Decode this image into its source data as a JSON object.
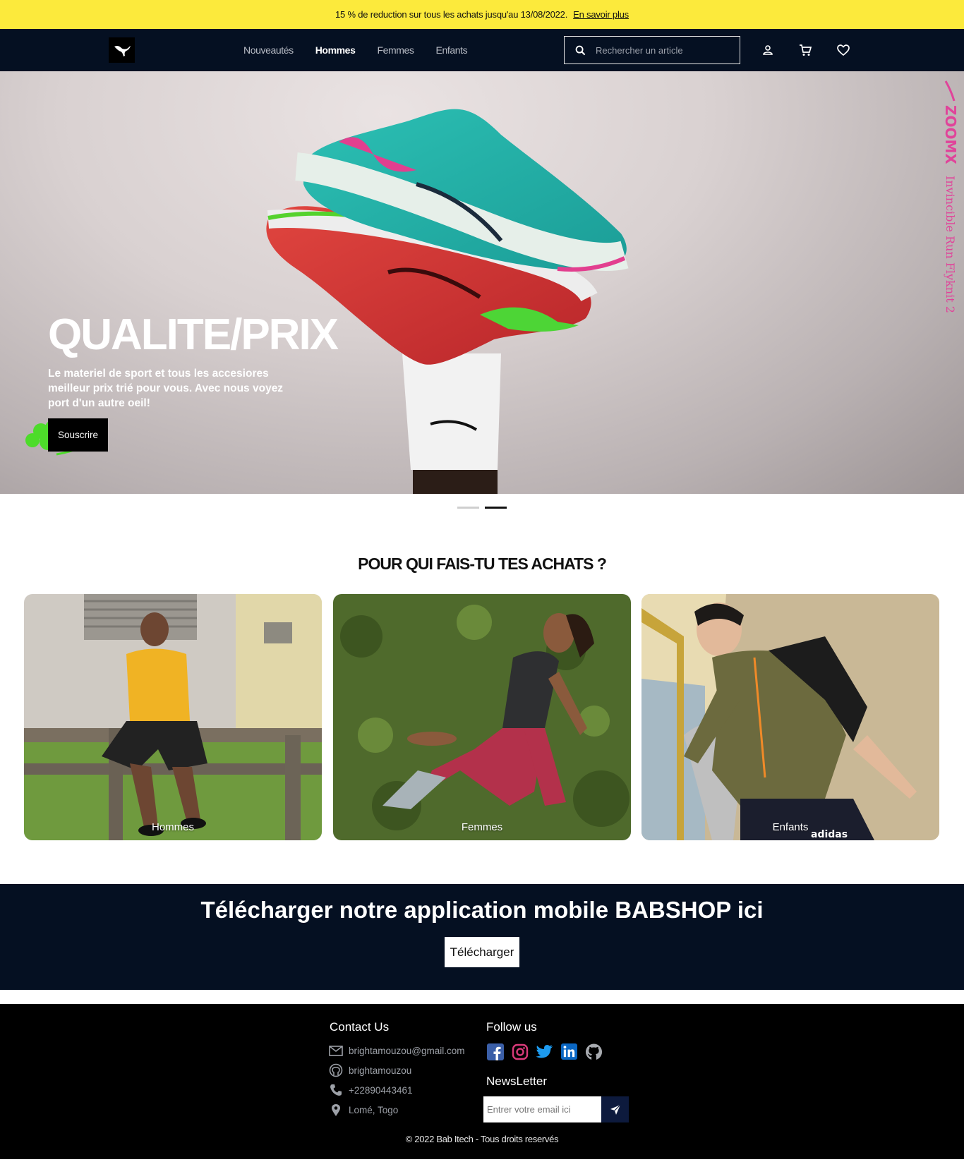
{
  "promo": {
    "text": "15 % de reduction sur tous les achats jusqu'au 13/08/2022.",
    "link": "En savoir plus"
  },
  "nav": {
    "links": [
      "Nouveautés",
      "Hommes",
      "Femmes",
      "Enfants"
    ],
    "active": "Hommes",
    "search_placeholder": "Rechercher un article",
    "icons": [
      "user-icon",
      "cart-icon",
      "heart-icon"
    ]
  },
  "hero": {
    "title": "QUALITE/PRIX",
    "text": "Le materiel de sport et tous les accesiores meilleur prix trié pour vous. Avec nous voyez port d'un autre oeil!",
    "button": "Souscrire",
    "vertical_brand": "ZOOMX",
    "vertical_product": "Invincible Run Flyknit 2",
    "slides": 2,
    "active_slide": 2
  },
  "section": {
    "title": "POUR QUI FAIS-TU TES ACHATS ?"
  },
  "categories": [
    {
      "label": "Hommes"
    },
    {
      "label": "Femmes"
    },
    {
      "label": "Enfants"
    }
  ],
  "app": {
    "title": "Télécharger notre application mobile BABSHOP ici",
    "button": "Télécharger"
  },
  "footer": {
    "contact_title": "Contact Us",
    "email": "brightamouzou@gmail.com",
    "github": "brightamouzou",
    "phone": "+22890443461",
    "location": "Lomé, Togo",
    "follow_title": "Follow us",
    "socials": [
      "facebook-icon",
      "instagram-icon",
      "twitter-icon",
      "linkedin-icon",
      "github-icon"
    ],
    "newsletter_title": "NewsLetter",
    "newsletter_placeholder": "Entrer votre email ici",
    "copyright": "© 2022 Bab Itech - Tous droits reservés"
  },
  "colors": {
    "promo_bg": "#fcea3c",
    "nav_bg": "#051022",
    "footer_bg": "#000000",
    "accent_pink": "#e0449a"
  }
}
